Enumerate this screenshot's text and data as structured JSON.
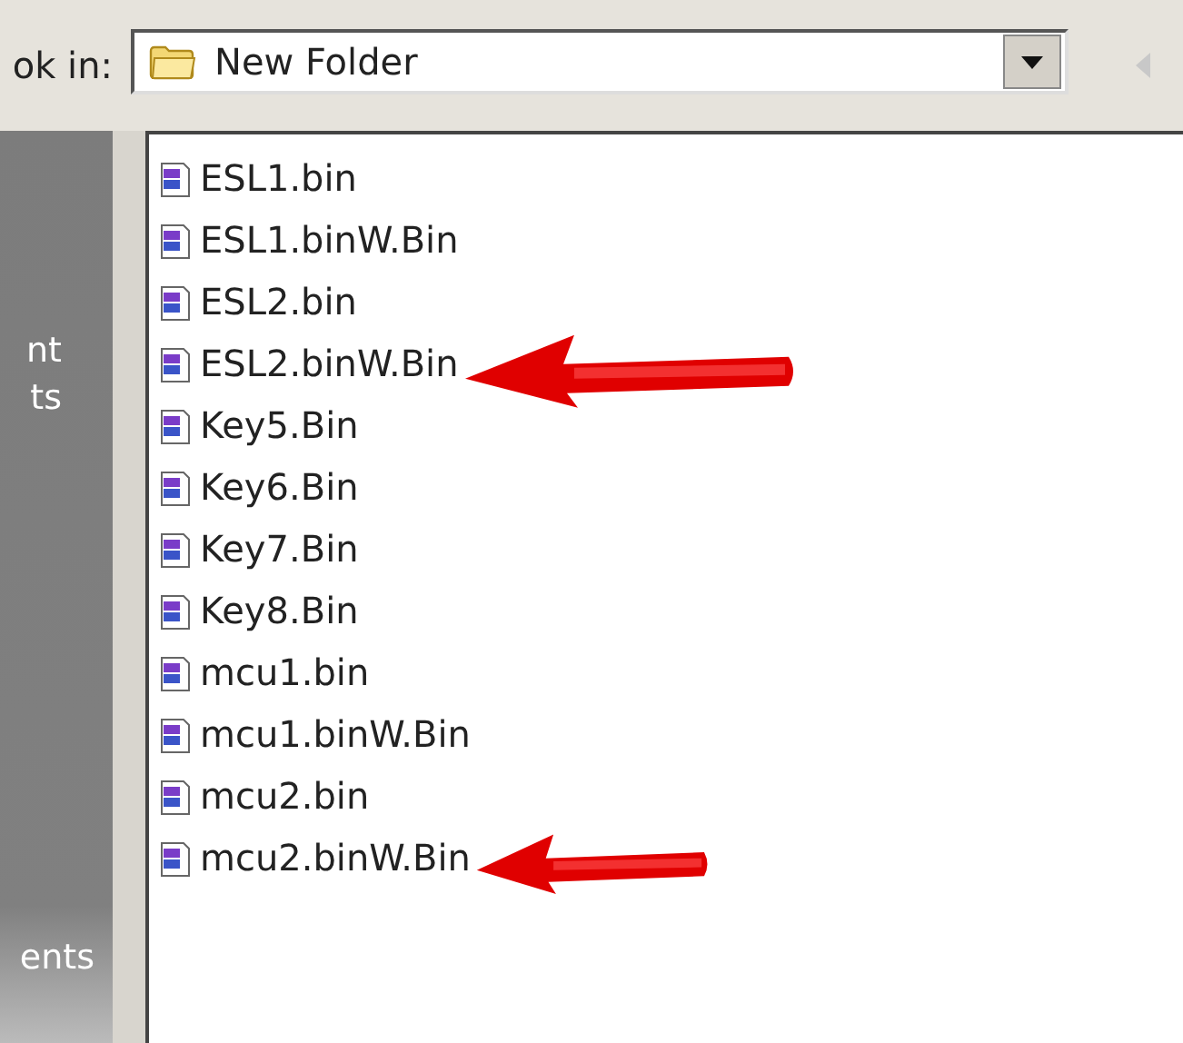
{
  "look_in": {
    "label": "ok in:",
    "value": "New Folder"
  },
  "sidebar": {
    "labels": [
      "nt",
      "ts",
      "ents"
    ]
  },
  "files": [
    {
      "name": "ESL1.bin",
      "kind": "plain"
    },
    {
      "name": "ESL1.binW.Bin",
      "kind": "plain"
    },
    {
      "name": "ESL2.bin",
      "kind": "plain"
    },
    {
      "name": "ESL2.binW.Bin",
      "kind": "bigarrow"
    },
    {
      "name": "Key5.Bin",
      "kind": "plain"
    },
    {
      "name": "Key6.Bin",
      "kind": "plain"
    },
    {
      "name": "Key7.Bin",
      "kind": "plain"
    },
    {
      "name": "Key8.Bin",
      "kind": "plain"
    },
    {
      "name": "mcu1.bin",
      "kind": "plain"
    },
    {
      "name": "mcu1.binW.Bin",
      "kind": "plain"
    },
    {
      "name": "mcu2.bin",
      "kind": "plain"
    },
    {
      "name": "mcu2.binW.Bin",
      "kind": "smallarrow"
    }
  ]
}
